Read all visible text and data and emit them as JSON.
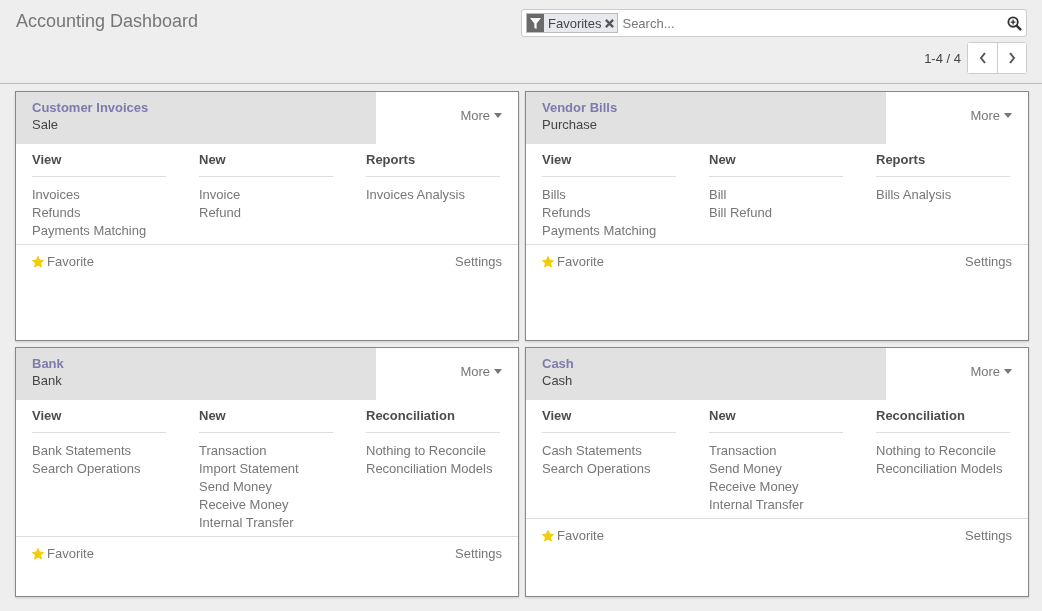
{
  "title": "Accounting Dashboard",
  "search": {
    "facet": "Favorites",
    "placeholder": "Search..."
  },
  "pager": {
    "text": "1-4 / 4"
  },
  "journals": [
    {
      "name": "Customer Invoices",
      "type": "Sale",
      "more": "More",
      "favorite_label": "Favorite",
      "favorite": true,
      "settings": "Settings",
      "columns": [
        {
          "heading": "View",
          "links": [
            "Invoices",
            "Refunds",
            "Payments Matching"
          ]
        },
        {
          "heading": "New",
          "links": [
            "Invoice",
            "Refund"
          ]
        },
        {
          "heading": "Reports",
          "links": [
            "Invoices Analysis"
          ]
        }
      ]
    },
    {
      "name": "Vendor Bills",
      "type": "Purchase",
      "more": "More",
      "favorite_label": "Favorite",
      "favorite": true,
      "settings": "Settings",
      "columns": [
        {
          "heading": "View",
          "links": [
            "Bills",
            "Refunds",
            "Payments Matching"
          ]
        },
        {
          "heading": "New",
          "links": [
            "Bill",
            "Bill Refund"
          ]
        },
        {
          "heading": "Reports",
          "links": [
            "Bills Analysis"
          ]
        }
      ]
    },
    {
      "name": "Bank",
      "type": "Bank",
      "more": "More",
      "favorite_label": "Favorite",
      "favorite": true,
      "settings": "Settings",
      "columns": [
        {
          "heading": "View",
          "links": [
            "Bank Statements",
            "Search Operations"
          ]
        },
        {
          "heading": "New",
          "links": [
            "Transaction",
            "Import Statement",
            "Send Money",
            "Receive Money",
            "Internal Transfer"
          ]
        },
        {
          "heading": "Reconciliation",
          "links": [
            "Nothing to Reconcile",
            "Reconciliation Models"
          ]
        }
      ]
    },
    {
      "name": "Cash",
      "type": "Cash",
      "more": "More",
      "favorite_label": "Favorite",
      "favorite": true,
      "settings": "Settings",
      "columns": [
        {
          "heading": "View",
          "links": [
            "Cash Statements",
            "Search Operations"
          ]
        },
        {
          "heading": "New",
          "links": [
            "Transaction",
            "Send Money",
            "Receive Money",
            "Internal Transfer"
          ]
        },
        {
          "heading": "Reconciliation",
          "links": [
            "Nothing to Reconcile",
            "Reconciliation Models"
          ]
        }
      ]
    }
  ]
}
